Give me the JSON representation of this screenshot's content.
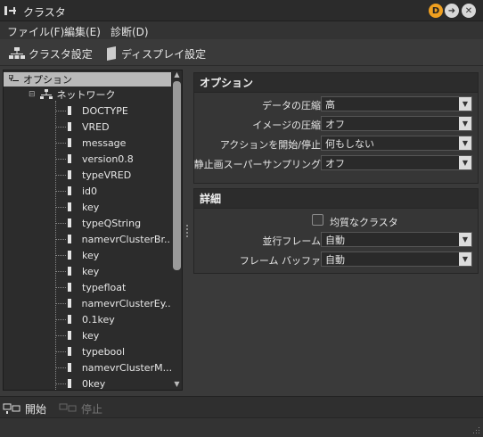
{
  "window": {
    "title": "クラスタ",
    "title_buttons": {
      "d_label": "D"
    }
  },
  "menu": [
    "ファイル(F)",
    "編集(E)",
    "診断(D)"
  ],
  "toolbar": {
    "cluster_settings": "クラスタ設定",
    "display_settings": "ディスプレイ設定"
  },
  "tree": {
    "root": "オプション",
    "network": "ネットワーク",
    "leaves": [
      "DOCTYPE",
      "VRED",
      "message",
      "version0.8",
      "typeVRED",
      "id0",
      "key",
      "typeQString",
      "namevrClusterBr...",
      "key",
      "key",
      "typefloat",
      "namevrClusterEy...",
      "0.1key",
      "key",
      "typebool",
      "namevrClusterM...",
      "0key"
    ]
  },
  "options": {
    "header": "オプション",
    "rows": [
      {
        "label": "データの圧縮",
        "value": "高"
      },
      {
        "label": "イメージの圧縮",
        "value": "オフ"
      },
      {
        "label": "アクションを開始/停止",
        "value": "何もしない"
      },
      {
        "label": "静止画スーパーサンプリング",
        "value": "オフ"
      }
    ]
  },
  "details": {
    "header": "詳細",
    "uniform_cluster": "均質なクラスタ",
    "rows": [
      {
        "label": "並行フレーム",
        "value": "自動"
      },
      {
        "label": "フレーム バッファ",
        "value": "自動"
      }
    ]
  },
  "bottom": {
    "start": "開始",
    "stop": "停止"
  },
  "colors": {
    "accent_orange": "#f0a020",
    "selected_row": "#b9b9b9",
    "disabled_text": "#777777"
  }
}
